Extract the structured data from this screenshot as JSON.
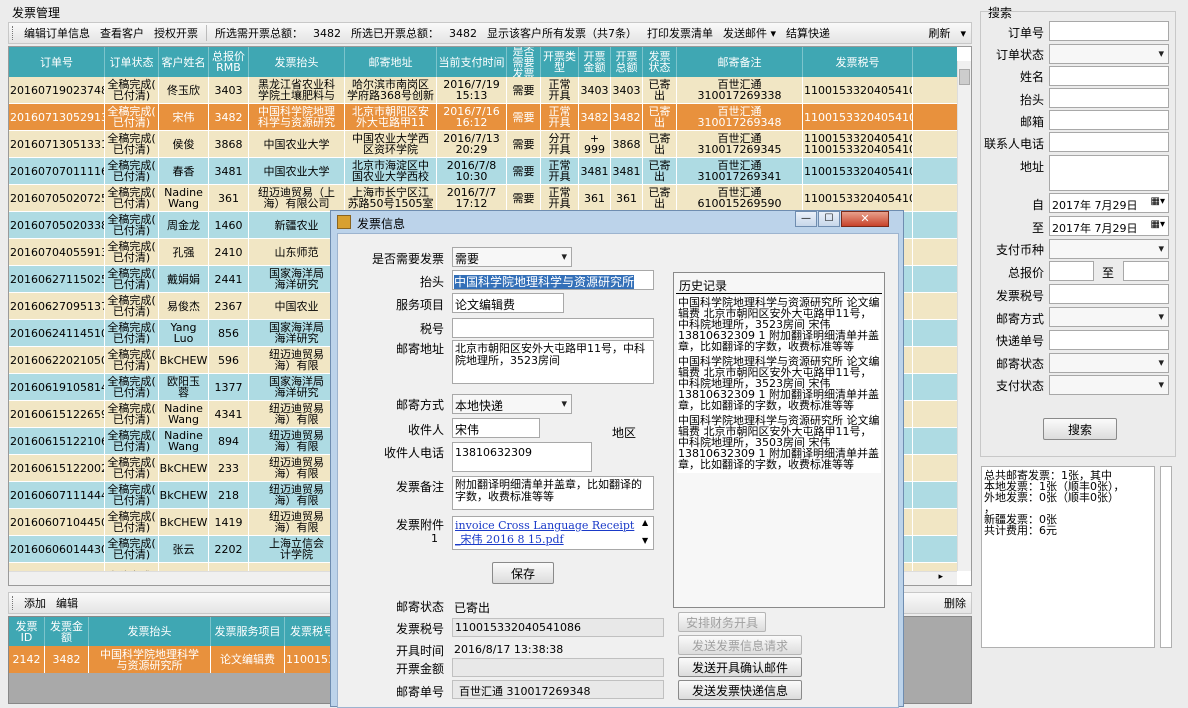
{
  "app": {
    "title": "发票管理"
  },
  "toolbar": {
    "edit_order": "编辑订单信息",
    "view_customer": "查看客户",
    "authorize_invoice": "授权开票",
    "selected_total_label": "所选需开票总额：",
    "selected_total": "3482",
    "selected_issued_label": "所选已开票总额：",
    "selected_issued": "3482",
    "show_all_invoices": "显示该客户所有发票（共7条）",
    "print_list": "打印发票清单",
    "send_mail": "发送邮件",
    "quick_settle": "结算快递",
    "refresh": "刷新"
  },
  "grid": {
    "columns": [
      "订单号",
      "订单状态",
      "客户姓名",
      "总报价RMB",
      "发票抬头",
      "邮寄地址",
      "当前支付时间",
      "是否需要发票",
      "开票类型",
      "开票金额",
      "开票总额",
      "发票状态",
      "邮寄备注",
      "发票税号"
    ],
    "rows": [
      [
        "20160719023748",
        "全稿完成(\n已付清)",
        "佟玉欣",
        "3403",
        "黑龙江省农业科\n学院土壤肥料与",
        "哈尔滨市南岗区\n学府路368号创新",
        "2016/7/19\n15:13",
        "需要",
        "正常\n开具",
        "3403",
        "3403",
        "已寄\n出",
        "百世汇通\n310017269338",
        "11001533204054108"
      ],
      [
        "20160713052913",
        "全稿完成(\n已付清)",
        "宋伟",
        "3482",
        "中国科学院地理\n科学与资源研究",
        "北京市朝阳区安\n外大屯路甲11",
        "2016/7/16\n16:12",
        "需要",
        "正常\n开具",
        "3482",
        "3482",
        "已寄\n出",
        "百世汇通\n310017269348",
        "11001533204054108"
      ],
      [
        "20160713051331",
        "全稿完成(\n已付清)",
        "侯俊",
        "3868",
        "中国农业大学",
        "中国农业大学西\n区资环学院",
        "2016/7/13\n20:29",
        "需要",
        "分开\n开具",
        "999 +\n999 +",
        "3868",
        "已寄\n出",
        "百世汇通\n310017269345",
        "11001533204054108\n11001533204054108"
      ],
      [
        "20160707011116",
        "全稿完成(\n已付清)",
        "春香",
        "3481",
        "中国农业大学",
        "北京市海淀区中\n国农业大学西校",
        "2016/7/8\n10:30",
        "需要",
        "正常\n开具",
        "3481",
        "3481",
        "已寄\n出",
        "百世汇通\n310017269341",
        "11001533204054108"
      ],
      [
        "20160705020725",
        "全稿完成(\n已付清)",
        "Nadine\nWang",
        "361",
        "纽迈迪贸易（上\n海）有限公司",
        "上海市长宁区江\n苏路50号1505室",
        "2016/7/7\n17:12",
        "需要",
        "正常\n开具",
        "361",
        "361",
        "已寄\n出",
        "百世汇通\n610015269590",
        "11001533204054108"
      ],
      [
        "20160705020338",
        "全稿完成(\n已付清)",
        "周金龙",
        "1460",
        "新疆农业",
        "",
        "",
        "",
        "",
        "",
        "",
        "",
        "",
        "204054108"
      ],
      [
        "20160704055913",
        "全稿完成(\n已付清)",
        "孔强",
        "2410",
        "山东师范",
        "",
        "",
        "",
        "",
        "",
        "",
        "",
        "",
        "204054108"
      ],
      [
        "20160627115025",
        "全稿完成(\n已付清)",
        "戴娟娟",
        "2441",
        "国家海洋局\n海洋研究",
        "",
        "",
        "",
        "",
        "",
        "",
        "",
        "",
        "204054108"
      ],
      [
        "20160627095137",
        "全稿完成(\n已付清)",
        "易俊杰",
        "2367",
        "中国农业",
        "",
        "",
        "",
        "",
        "",
        "",
        "",
        "",
        "204054108"
      ],
      [
        "20160624114510",
        "全稿完成(\n已付清)",
        "Yang\nLuo",
        "856",
        "国家海洋局\n海洋研究",
        "",
        "",
        "",
        "",
        "",
        "",
        "",
        "",
        "204054108"
      ],
      [
        "20160622021050",
        "全稿完成(\n已付清)",
        "BkCHEW",
        "596",
        "纽迈迪贸易\n海）有限",
        "",
        "",
        "",
        "",
        "",
        "",
        "",
        "",
        "204054108"
      ],
      [
        "20160619105814",
        "全稿完成(\n已付清)",
        "欧阳玉\n蓉",
        "1377",
        "国家海洋局\n海洋研究",
        "",
        "",
        "",
        "",
        "",
        "",
        "",
        "",
        "204054108"
      ],
      [
        "20160615122659",
        "全稿完成(\n已付清)",
        "Nadine\nWang",
        "4341",
        "纽迈迪贸易\n海）有限",
        "",
        "",
        "",
        "",
        "",
        "",
        "",
        "",
        "204054108"
      ],
      [
        "20160615122106",
        "全稿完成(\n已付清)",
        "Nadine\nWang",
        "894",
        "纽迈迪贸易\n海）有限",
        "",
        "",
        "",
        "",
        "",
        "",
        "",
        "",
        "204054108"
      ],
      [
        "20160615122002",
        "全稿完成(\n已付清)",
        "BkCHEW",
        "233",
        "纽迈迪贸易\n海）有限",
        "",
        "",
        "",
        "",
        "",
        "",
        "",
        "",
        "204054108"
      ],
      [
        "20160607111444",
        "全稿完成(\n已付清)",
        "BkCHEW",
        "218",
        "纽迈迪贸易\n海）有限",
        "",
        "",
        "",
        "",
        "",
        "",
        "",
        "",
        "204054108"
      ],
      [
        "20160607104450",
        "全稿完成(\n已付清)",
        "BkCHEW",
        "1419",
        "纽迈迪贸易\n海）有限",
        "",
        "",
        "",
        "",
        "",
        "",
        "",
        "",
        "204054108"
      ],
      [
        "20160606014430",
        "全稿完成(\n已付清)",
        "张云",
        "2202",
        "上海立信会\n计学院",
        "",
        "",
        "",
        "",
        "",
        "",
        "",
        "",
        "204054108"
      ],
      [
        "",
        "全稿完成(",
        "",
        "",
        "",
        "",
        "",
        "",
        "",
        "",
        "",
        "",
        "",
        ""
      ]
    ]
  },
  "bottom_toolbar": {
    "add": "添加",
    "edit": "编辑",
    "delete": "删除"
  },
  "bottom_grid": {
    "columns": [
      "发票ID",
      "发票金额",
      "发票抬头",
      "发票服务项目",
      "发票税号"
    ],
    "row": [
      "2142",
      "3482",
      "中国科学院地理科学\n与资源研究所",
      "论文编辑费",
      "1100153"
    ]
  },
  "search": {
    "title": "搜索",
    "order_no": "订单号",
    "order_status": "订单状态",
    "name": "姓名",
    "header": "抬头",
    "email": "邮箱",
    "phone": "联系人电话",
    "address": "地址",
    "from": "自",
    "to": "至",
    "date_from": "2017年 7月29日",
    "date_to": "2017年 7月29日",
    "currency": "支付币种",
    "total_price": "总报价",
    "total_to": "至",
    "tax_no": "发票税号",
    "mail_method": "邮寄方式",
    "express_no": "快递单号",
    "mail_status": "邮寄状态",
    "pay_status": "支付状态",
    "search_btn": "搜索"
  },
  "summary": {
    "lines": [
      "总共邮寄发票：1张，其中",
      "本地发票：1张（顺丰0张），",
      "外地发票：0张（顺丰0张）",
      "，",
      "新疆发票：0张",
      "共计费用：6元"
    ]
  },
  "dialog": {
    "title": "发票信息",
    "need_invoice_label": "是否需要发票",
    "need_invoice": "需要",
    "header_label": "抬头",
    "header": "中国科学院地理科学与资源研究所",
    "service_label": "服务项目",
    "service": "论文编辑费",
    "tax_label": "税号",
    "tax": "",
    "address_label": "邮寄地址",
    "address": "北京市朝阳区安外大屯路甲11号，中科院地理所，3523房间",
    "mail_method_label": "邮寄方式",
    "mail_method": "本地快递",
    "recipient_label": "收件人",
    "recipient": "宋伟",
    "region_label": "地区",
    "phone_label": "收件人电话",
    "phone": "13810632309",
    "remark_label": "发票备注",
    "remark": "附加翻译明细清单并盖章，比如翻译的字数，收费标准等等",
    "attach_label": "发票附件",
    "attach_count": "1",
    "attach_file": "invoice Cross Language Receipt _宋伟 2016 8 15.pdf",
    "save": "保存",
    "history_title": "历史记录",
    "history": [
      "中国科学院地理科学与资源研究所 论文编辑费 北京市朝阳区安外大屯路甲11号，中科院地理所，3523房间 宋伟 13810632309 1 附加翻译明细清单并盖章，比如翻译的字数，收费标准等等",
      "中国科学院地理科学与资源研究所 论文编辑费 北京市朝阳区安外大屯路甲11号，中科院地理所，3523房间 宋伟 13810632309 1 附加翻译明细清单并盖章，比如翻译的字数，收费标准等等",
      "中国科学院地理科学与资源研究所 论文编辑费 北京市朝阳区安外大屯路甲11号，中科院地理所，3503房间 宋伟 13810632309 1 附加翻译明细清单并盖章，比如翻译的字数，收费标准等等"
    ],
    "mail_status_label": "邮寄状态",
    "mail_status": "已寄出",
    "tax_no_label": "发票税号",
    "tax_no": "110015332040541086",
    "issue_time_label": "开具时间",
    "issue_time": "2016/8/17 13:38:38",
    "amount_label": "开票金额",
    "amount": "",
    "track_label": "邮寄单号",
    "track": "百世汇通  310017269348",
    "btn_finance": "安排财务开具",
    "btn_send_request": "发送发票信息请求",
    "btn_send_confirm": "发送开具确认邮件",
    "btn_send_express": "发送发票快递信息"
  }
}
